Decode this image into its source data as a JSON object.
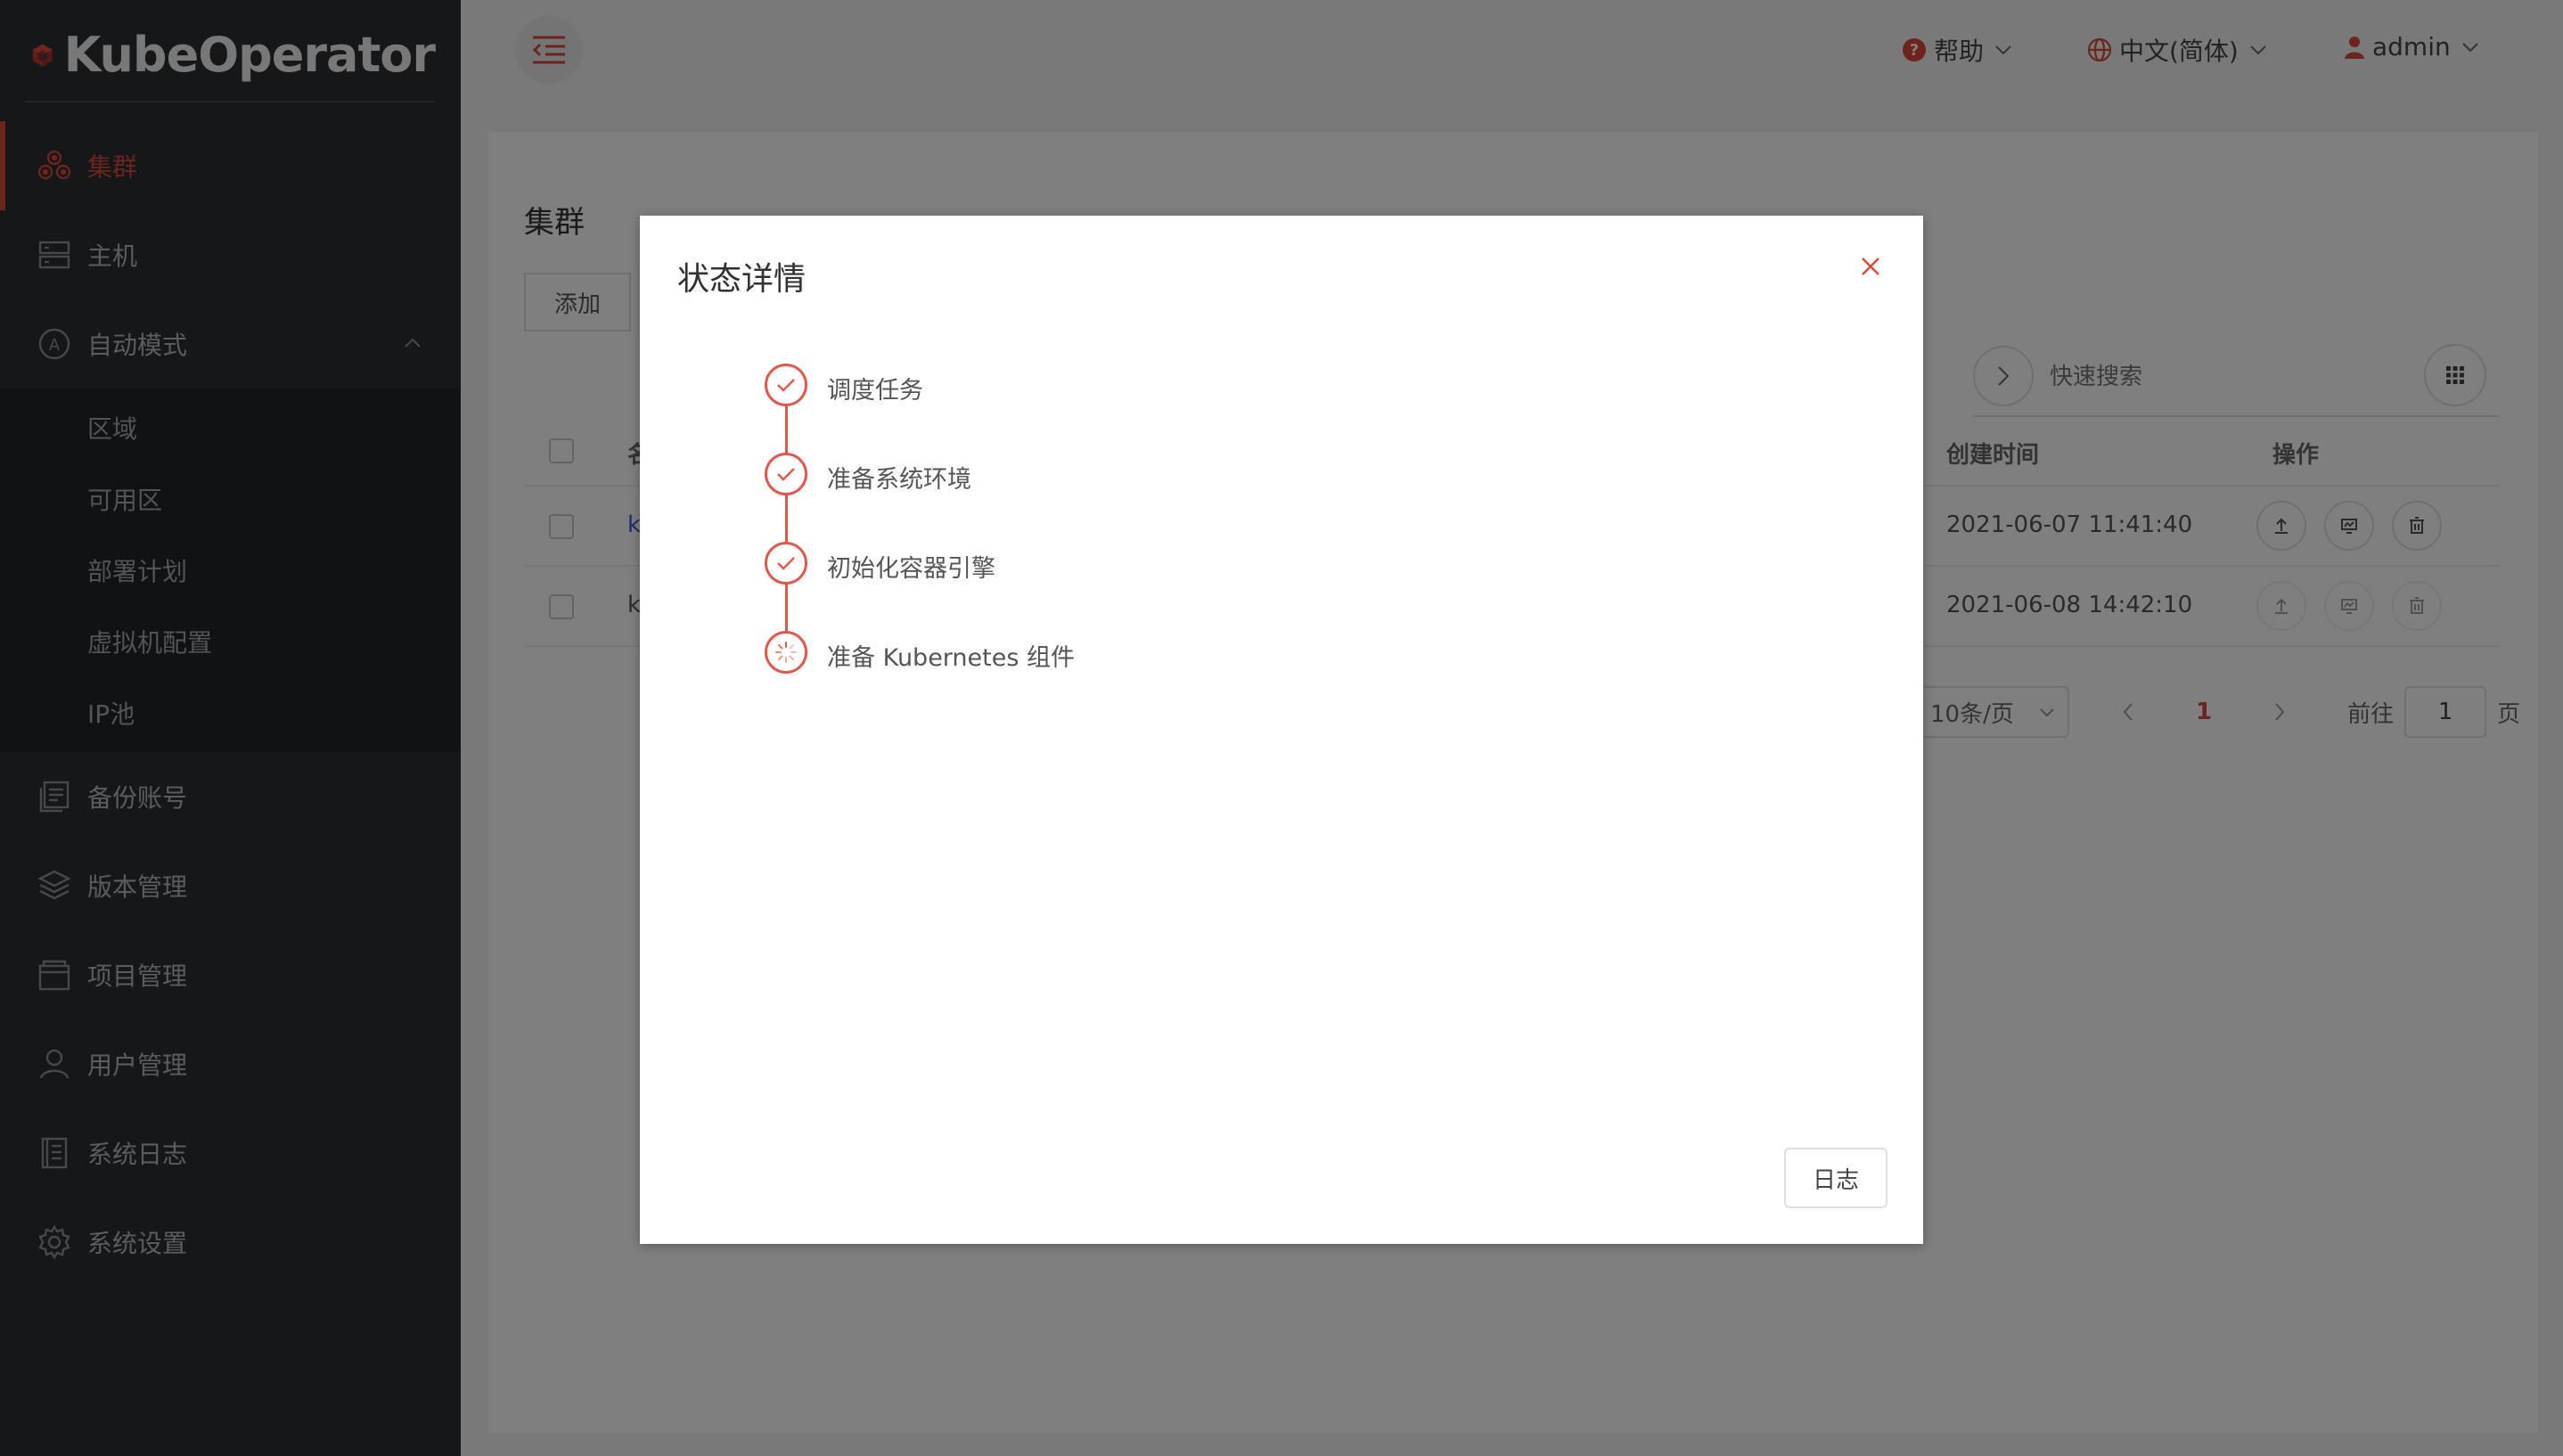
{
  "app": {
    "brand": "KubeOperator",
    "accent": "#d9483b"
  },
  "sidebar": {
    "items": [
      {
        "label": "集群",
        "icon": "cluster-icon",
        "active": true
      },
      {
        "label": "主机",
        "icon": "host-icon"
      },
      {
        "label": "自动模式",
        "icon": "auto-mode-icon",
        "expanded": true,
        "children": [
          {
            "label": "区域"
          },
          {
            "label": "可用区"
          },
          {
            "label": "部署计划"
          },
          {
            "label": "虚拟机配置"
          },
          {
            "label": "IP池"
          }
        ]
      },
      {
        "label": "备份账号",
        "icon": "backup-icon"
      },
      {
        "label": "版本管理",
        "icon": "layers-icon"
      },
      {
        "label": "项目管理",
        "icon": "project-icon"
      },
      {
        "label": "用户管理",
        "icon": "user-icon"
      },
      {
        "label": "系统日志",
        "icon": "log-icon"
      },
      {
        "label": "系统设置",
        "icon": "gear-icon"
      }
    ]
  },
  "header": {
    "help": "帮助",
    "language": "中文(简体)",
    "user": "admin"
  },
  "main": {
    "title": "集群",
    "add_button": "添加",
    "search_placeholder": "快速搜索",
    "table": {
      "headers": {
        "name": "名",
        "created": "创建时间",
        "ops": "操作"
      },
      "rows": [
        {
          "name": "k",
          "created": "2021-06-07 11:41:40"
        },
        {
          "name": "k",
          "created": "2021-06-08 14:42:10"
        }
      ]
    },
    "pager": {
      "page_size": "10条/页",
      "current": "1",
      "goto_label": "前往",
      "goto_value": "1",
      "page_suffix": "页"
    }
  },
  "dialog": {
    "title": "状态详情",
    "steps": [
      {
        "label": "调度任务",
        "status": "done"
      },
      {
        "label": "准备系统环境",
        "status": "done"
      },
      {
        "label": "初始化容器引擎",
        "status": "done"
      },
      {
        "label": "准备 Kubernetes 组件",
        "status": "running"
      }
    ],
    "log_button": "日志"
  }
}
